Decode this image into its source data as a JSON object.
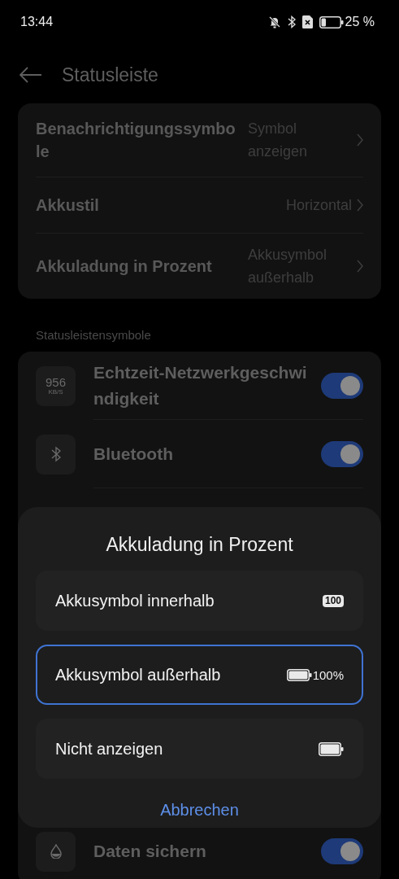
{
  "status_bar": {
    "time": "13:44",
    "battery_text": "25 %"
  },
  "header": {
    "title": "Statusleiste"
  },
  "settings": [
    {
      "label": "Benachrichtigungssymbole",
      "value": "Symbol anzeigen"
    },
    {
      "label": "Akkustil",
      "value": "Horizontal"
    },
    {
      "label": "Akkuladung in Prozent",
      "value": "Akkusymbol außerhalb"
    }
  ],
  "section_label": "Statusleistensymbole",
  "toggles": [
    {
      "kind": "speed",
      "icon_value": "956",
      "icon_unit": "KB/S",
      "label": "Echtzeit-Netzwerkgeschwindigkeit",
      "on": true
    },
    {
      "kind": "bluetooth",
      "label": "Bluetooth",
      "on": true
    },
    {
      "kind": "data",
      "label": "Daten sichern",
      "on": true
    }
  ],
  "sheet": {
    "title": "Akkuladung in Prozent",
    "options": [
      {
        "kind": "inside",
        "label": "Akkusymbol innerhalb",
        "badge": "100",
        "selected": false
      },
      {
        "kind": "outside",
        "label": "Akkusymbol außerhalb",
        "badge": "100%",
        "selected": true
      },
      {
        "kind": "none",
        "label": "Nicht anzeigen",
        "selected": false
      }
    ],
    "cancel": "Abbrechen"
  }
}
